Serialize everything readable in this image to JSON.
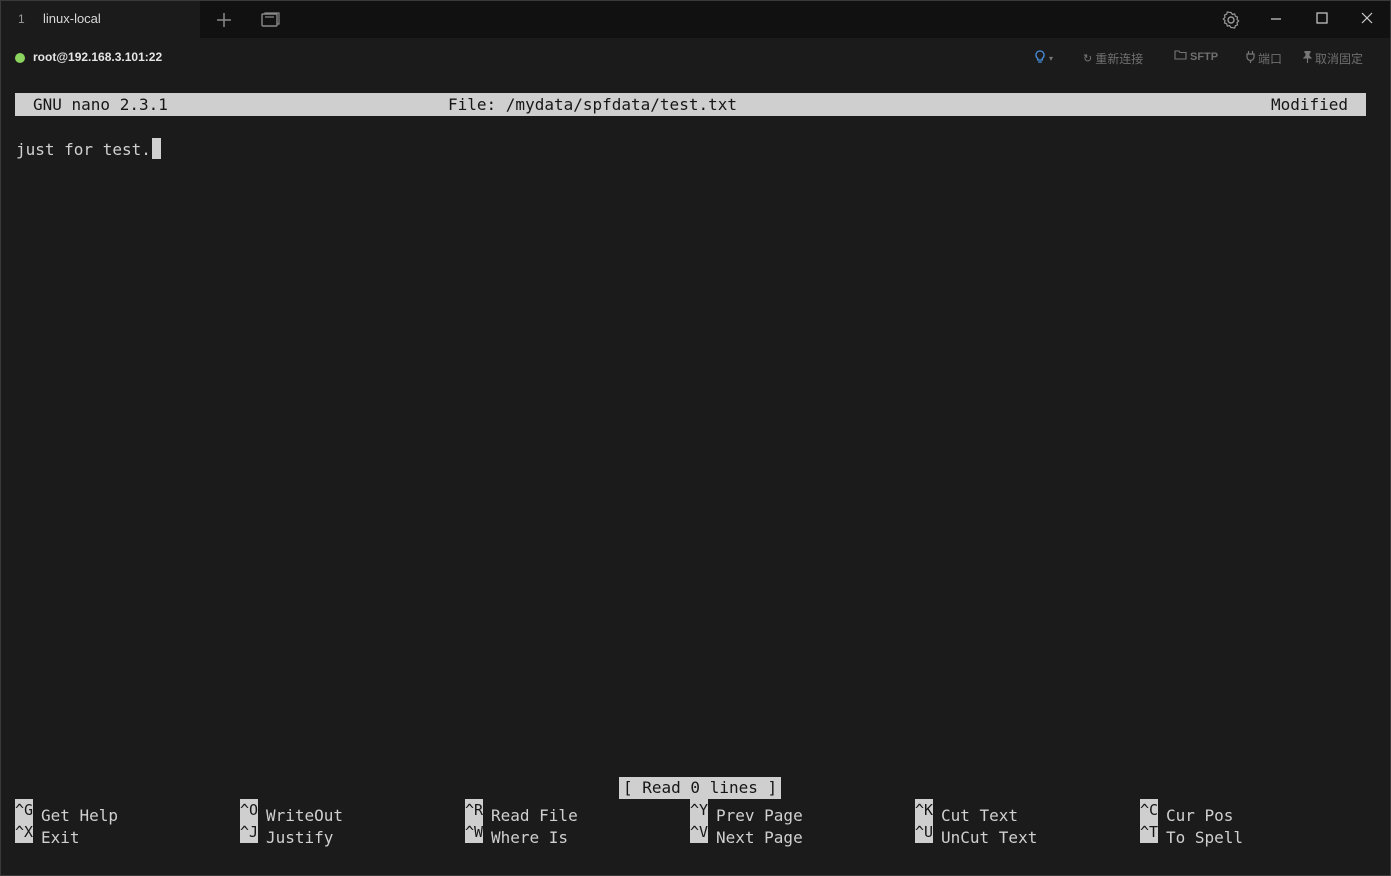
{
  "tabbar": {
    "tab": {
      "number": "1",
      "title": "linux-local"
    },
    "icons": [
      "plus-icon",
      "window-icon",
      "gear-icon",
      "minimize-icon",
      "maximize-icon",
      "close-icon"
    ]
  },
  "connection": {
    "status_color": "#8bd45f",
    "label": "root@192.168.3.101:22",
    "tools": {
      "bulb_icon": "lightbulb-icon",
      "reconnect": "重新连接",
      "sftp": "SFTP",
      "port": "端口",
      "unpin": "取消固定"
    }
  },
  "nano": {
    "header": {
      "version": "GNU nano 2.3.1",
      "file": "File: /mydata/spfdata/test.txt",
      "state": "Modified"
    },
    "content": "just for test.",
    "status_message": "[ Read 0 lines ]",
    "shortcuts_row1": [
      {
        "key": "^G",
        "label": "Get Help"
      },
      {
        "key": "^O",
        "label": "WriteOut"
      },
      {
        "key": "^R",
        "label": "Read File"
      },
      {
        "key": "^Y",
        "label": "Prev Page"
      },
      {
        "key": "^K",
        "label": "Cut Text"
      },
      {
        "key": "^C",
        "label": "Cur Pos"
      }
    ],
    "shortcuts_row2": [
      {
        "key": "^X",
        "label": "Exit"
      },
      {
        "key": "^J",
        "label": "Justify"
      },
      {
        "key": "^W",
        "label": "Where Is"
      },
      {
        "key": "^V",
        "label": "Next Page"
      },
      {
        "key": "^U",
        "label": "UnCut Text"
      },
      {
        "key": "^T",
        "label": "To Spell"
      }
    ]
  }
}
